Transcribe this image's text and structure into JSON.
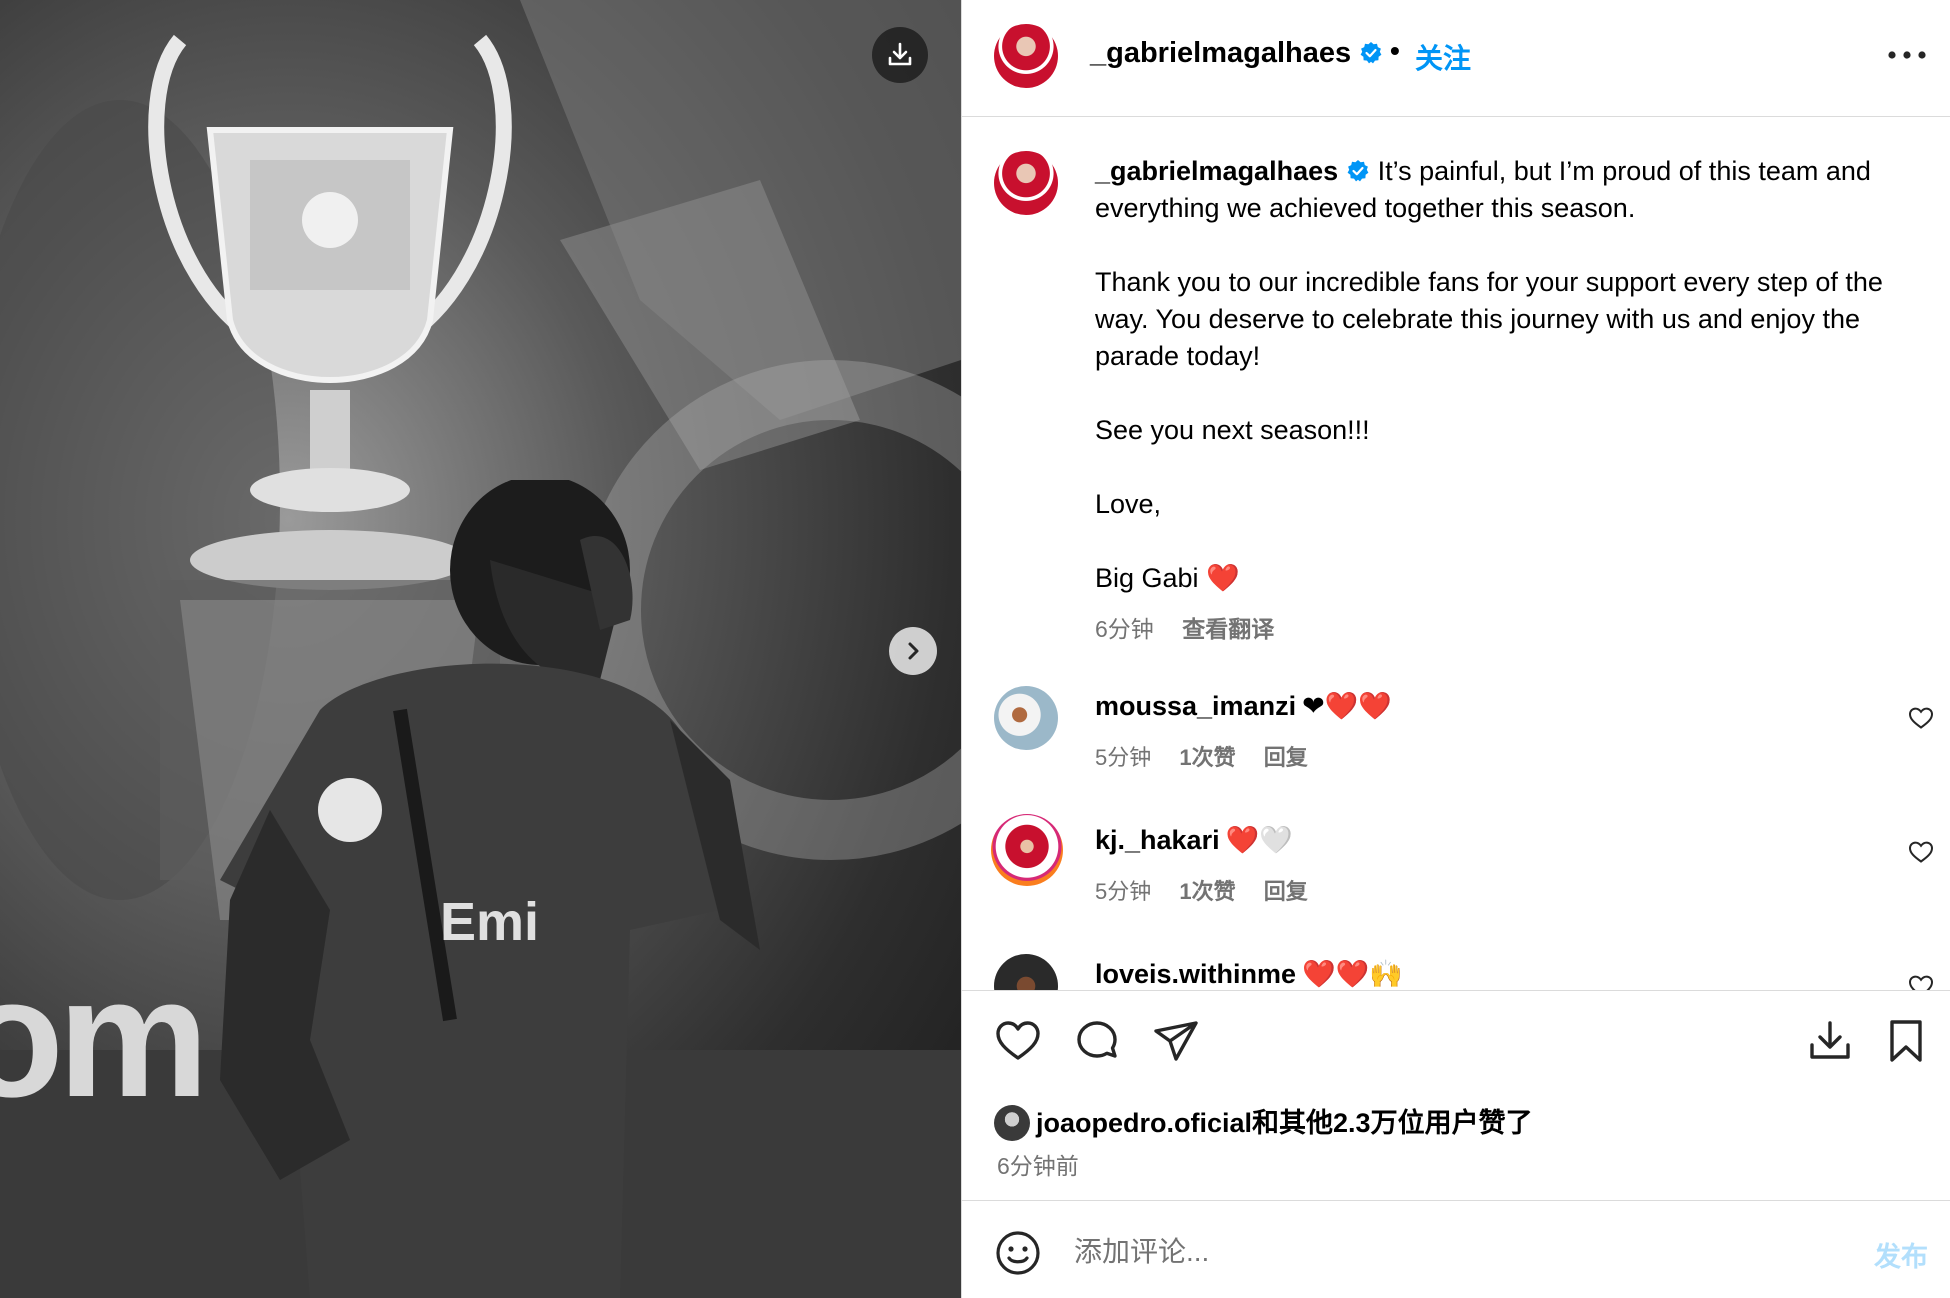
{
  "photo": {
    "banner_text": "om"
  },
  "header": {
    "username": "_gabrielmagalhaes",
    "separator": "•",
    "follow_label": "关注"
  },
  "caption": {
    "username": "_gabrielmagalhaes",
    "text": " It’s painful, but I’m proud of this team and everything we achieved together this season.\n\nThank you to our incredible fans for your support every step of the way. You deserve to celebrate this journey with us and enjoy the parade today!\n\nSee you next season!!!\n\nLove,\n\nBig Gabi ❤️",
    "time": "6分钟",
    "translate_label": "查看翻译"
  },
  "comments": [
    {
      "username": "moussa_imanzi",
      "text": "❤❤️❤️",
      "time": "5分钟",
      "likes": "1次赞",
      "reply_label": "回复"
    },
    {
      "username": "kj._hakari",
      "text": "❤️🤍",
      "time": "5分钟",
      "likes": "1次赞",
      "reply_label": "回复"
    },
    {
      "username": "loveis.withinme",
      "text": "❤️❤️🙌",
      "time": "",
      "likes": "",
      "reply_label": ""
    }
  ],
  "likes": {
    "liker": "joaopedro.oficial",
    "suffix": "和其他2.3万位用户赞了"
  },
  "post_time": "6分钟前",
  "comment_box": {
    "placeholder": "添加评论...",
    "post_label": "发布"
  },
  "colors": {
    "accent": "#0095f6",
    "secondary_text": "#737373",
    "divider": "#dbdbdb",
    "post_disabled": "#b2dffc"
  }
}
